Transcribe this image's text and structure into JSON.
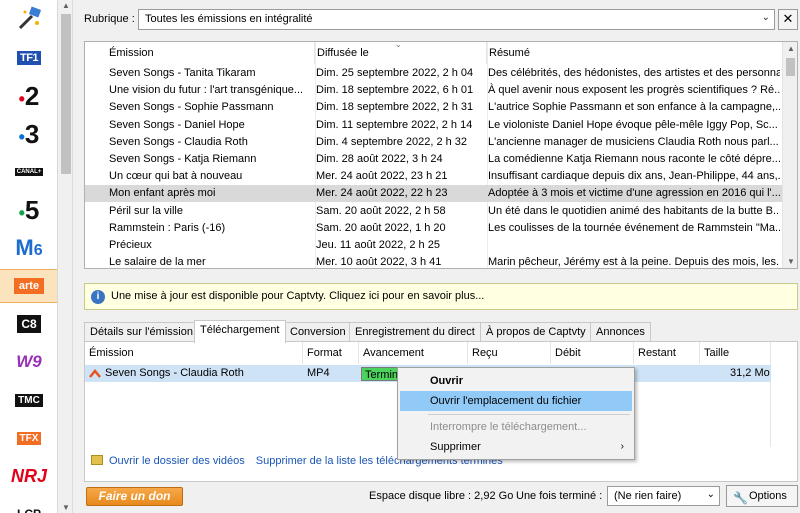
{
  "channels": [
    {
      "name": "TF1",
      "icon": "tf1-logo-icon"
    },
    {
      "name": "2",
      "icon": "france2-logo-icon"
    },
    {
      "name": "3",
      "icon": "france3-logo-icon"
    },
    {
      "name": "CANAL+",
      "icon": "canalplus-logo-icon"
    },
    {
      "name": "5",
      "icon": "france5-logo-icon"
    },
    {
      "name": "6",
      "icon": "m6-logo-icon"
    },
    {
      "name": "arte",
      "icon": "arte-logo-icon"
    },
    {
      "name": "C8",
      "icon": "c8-logo-icon"
    },
    {
      "name": "W9",
      "icon": "w9-logo-icon"
    },
    {
      "name": "TMC",
      "icon": "tmc-logo-icon"
    },
    {
      "name": "TFX",
      "icon": "tfx-logo-icon"
    },
    {
      "name": "NRJ",
      "icon": "nrj12-logo-icon"
    },
    {
      "name": "LCP",
      "icon": "lcp-logo-icon"
    }
  ],
  "rubrique": {
    "label": "Rubrique :",
    "value": "Toutes les émissions en intégralité"
  },
  "emissions": {
    "headers": [
      "Émission",
      "Diffusée le",
      "Résumé"
    ],
    "rows": [
      {
        "title": "Seven Songs - Tanita Tikaram",
        "date": "Dim. 25 septembre 2022, 2 h 04",
        "summary": "Des célébrités, des hédonistes, des artistes et des personna..."
      },
      {
        "title": "Une vision du futur : l'art transgénique...",
        "date": "Dim. 18 septembre 2022, 6 h 01",
        "summary": "À quel avenir nous exposent les progrès scientifiques ? Ré..."
      },
      {
        "title": "Seven Songs - Sophie Passmann",
        "date": "Dim. 18 septembre 2022, 2 h 31",
        "summary": "L'autrice Sophie Passmann et son enfance à la campagne,..."
      },
      {
        "title": "Seven Songs - Daniel Hope",
        "date": "Dim. 11 septembre 2022, 2 h 14",
        "summary": "Le violoniste Daniel Hope évoque pêle-mêle Iggy Pop, Sc..."
      },
      {
        "title": "Seven Songs - Claudia Roth",
        "date": "Dim. 4 septembre 2022, 2 h 32",
        "summary": "L'ancienne manager de musiciens Claudia Roth nous parl..."
      },
      {
        "title": "Seven Songs - Katja Riemann",
        "date": "Dim. 28 août 2022, 3 h 24",
        "summary": "La comédienne Katja Riemann nous raconte le côté dépre..."
      },
      {
        "title": "Un cœur qui bat à nouveau",
        "date": "Mer. 24 août 2022, 23 h 21",
        "summary": "Insuffisant cardiaque depuis dix ans, Jean-Philippe, 44 ans,..."
      },
      {
        "title": "Mon enfant après moi",
        "date": "Mer. 24 août 2022, 22 h 23",
        "summary": "Adoptée à 3 mois et victime d'une agression en 2016 qui l'..."
      },
      {
        "title": "Péril sur la ville",
        "date": "Sam. 20 août 2022, 2 h 58",
        "summary": "Un été dans le quotidien animé des habitants de la butte B..."
      },
      {
        "title": "Rammstein : Paris (-16)",
        "date": "Sam. 20 août 2022, 1 h 20",
        "summary": "Les coulisses de la tournée événement de Rammstein \"Ma..."
      },
      {
        "title": "Précieux",
        "date": "Jeu. 11 août 2022, 2 h 25",
        "summary": ""
      },
      {
        "title": "Le salaire de la mer",
        "date": "Mer. 10 août 2022, 3 h 41",
        "summary": "Marin pêcheur, Jérémy est à la peine. Depuis des mois, les..."
      }
    ]
  },
  "banner": {
    "text": "Une mise à jour est disponible pour Captvty. Cliquez ici pour en savoir plus..."
  },
  "tabs": [
    "Détails sur l'émission",
    "Téléchargement",
    "Conversion",
    "Enregistrement du direct",
    "À propos de Captvty",
    "Annonces"
  ],
  "downloads": {
    "headers": [
      "Émission",
      "Format",
      "Avancement",
      "Reçu",
      "Débit",
      "Restant",
      "Taille"
    ],
    "row": {
      "title": "Seven Songs - Claudia Roth",
      "format": "MP4",
      "status": "Terminé",
      "progress": 1.0,
      "size": "31,2 Mo"
    },
    "open_folder": "Ouvrir le dossier des vidéos",
    "remove_finished": "Supprimer de la liste les téléchargements terminés"
  },
  "context_menu": {
    "open": "Ouvrir",
    "open_location": "Ouvrir l'emplacement du fichier",
    "interrupt": "Interrompre le téléchargement...",
    "delete": "Supprimer"
  },
  "bottom": {
    "donate": "Faire un don",
    "disk_space": "Espace disque libre : 2,92 Go",
    "after_label": "Une fois terminé :",
    "after_value": "(Ne rien faire)",
    "options": "Options"
  }
}
